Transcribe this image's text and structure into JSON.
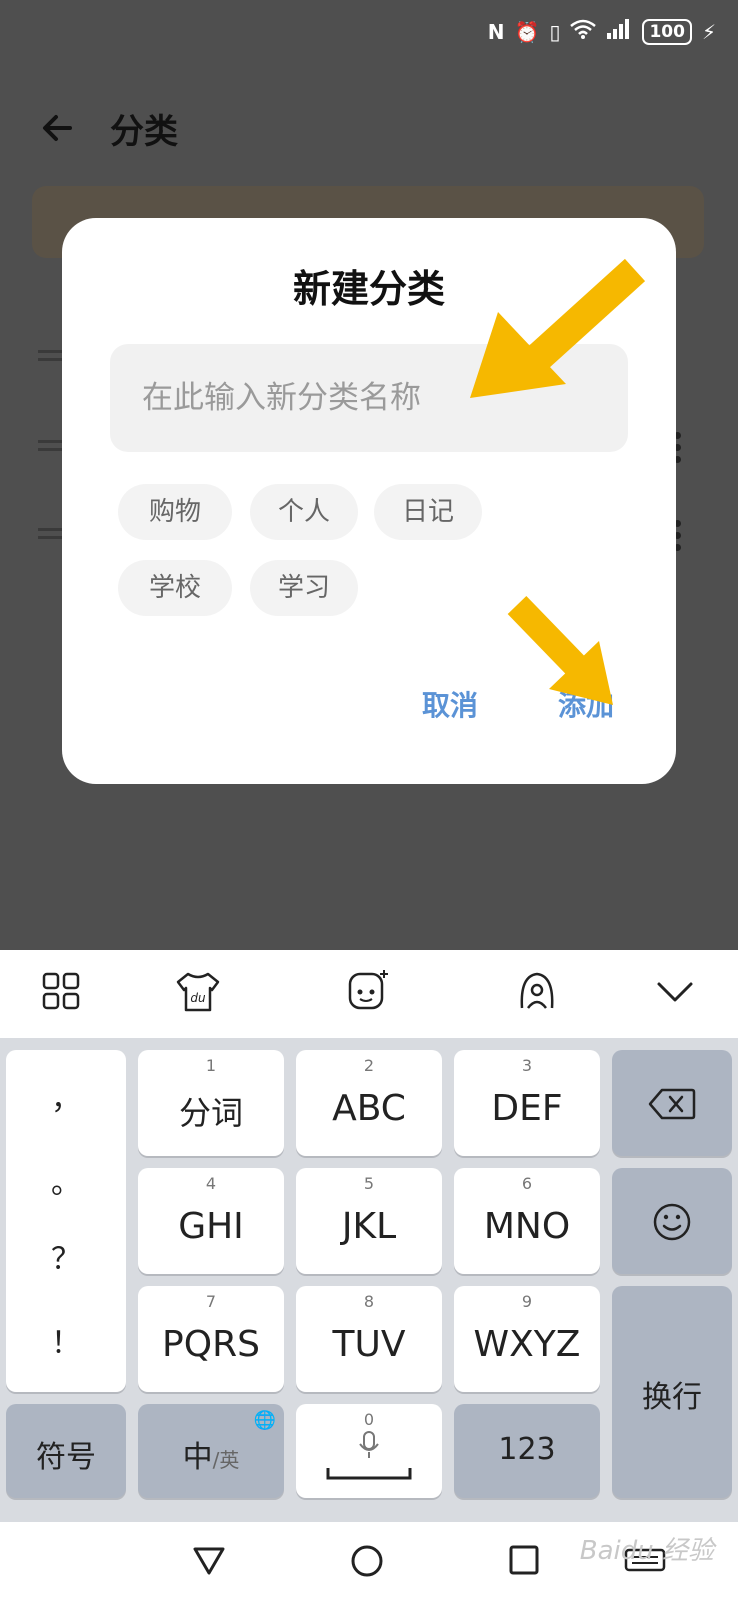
{
  "page": {
    "title": "分类"
  },
  "status_bar": {
    "battery": "100"
  },
  "dialog": {
    "title": "新建分类",
    "input_placeholder": "在此输入新分类名称",
    "chips": [
      "购物",
      "个人",
      "日记",
      "学校",
      "学习"
    ],
    "cancel_label": "取消",
    "add_label": "添加"
  },
  "keyboard": {
    "punctuation": [
      "，",
      "。",
      "？",
      "！"
    ],
    "keys": [
      {
        "num": "1",
        "label": "分词"
      },
      {
        "num": "2",
        "label": "ABC"
      },
      {
        "num": "3",
        "label": "DEF"
      },
      {
        "num": "4",
        "label": "GHI"
      },
      {
        "num": "5",
        "label": "JKL"
      },
      {
        "num": "6",
        "label": "MNO"
      },
      {
        "num": "7",
        "label": "PQRS"
      },
      {
        "num": "8",
        "label": "TUV"
      },
      {
        "num": "9",
        "label": "WXYZ"
      }
    ],
    "symbols_label": "符号",
    "lang_main": "中",
    "lang_alt": "/英",
    "space_num": "0",
    "numbers_label": "123",
    "enter_label": "换行"
  },
  "watermark": "Baidu 经验",
  "colors": {
    "accent": "#5b93d6",
    "arrow": "#f6b800",
    "dim_background": "#4f4f4f"
  }
}
